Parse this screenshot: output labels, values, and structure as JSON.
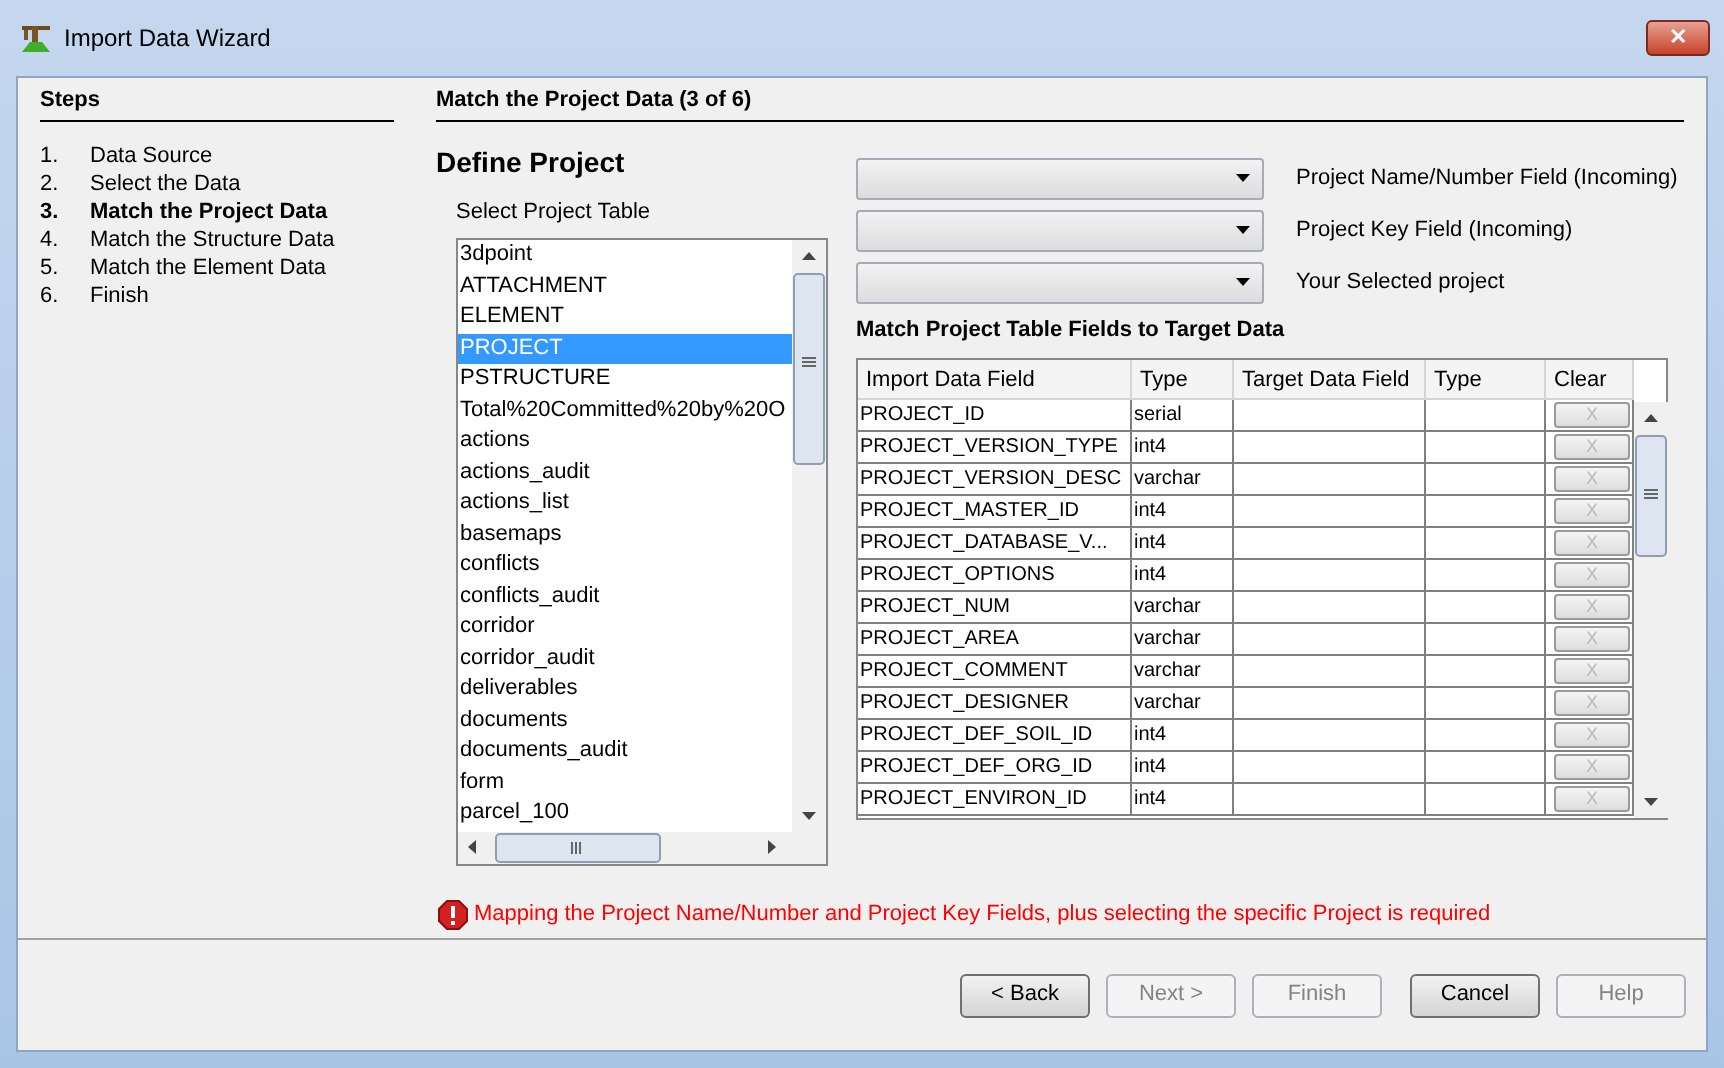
{
  "window": {
    "title": "Import Data Wizard",
    "close": "✕"
  },
  "steps": {
    "title": "Steps",
    "items": [
      {
        "number": "1.",
        "label": "Data Source",
        "selected": false
      },
      {
        "number": "2.",
        "label": "Select the Data",
        "selected": false
      },
      {
        "number": "3.",
        "label": "Match the Project Data",
        "selected": true
      },
      {
        "number": "4.",
        "label": "Match the Structure Data",
        "selected": false
      },
      {
        "number": "5.",
        "label": "Match the Element Data",
        "selected": false
      },
      {
        "number": "6.",
        "label": "Finish",
        "selected": false
      }
    ]
  },
  "page": {
    "title": "Match the Project Data (3 of 6)",
    "heading": "Define Project",
    "table_list": {
      "label": "Select Project Table",
      "items": [
        {
          "label": "3dpoint",
          "selected": false
        },
        {
          "label": "ATTACHMENT",
          "selected": false
        },
        {
          "label": "ELEMENT",
          "selected": false
        },
        {
          "label": "PROJECT",
          "selected": true
        },
        {
          "label": "PSTRUCTURE",
          "selected": false
        },
        {
          "label": "Total%20Committed%20by%20O",
          "selected": false
        },
        {
          "label": "actions",
          "selected": false
        },
        {
          "label": "actions_audit",
          "selected": false
        },
        {
          "label": "actions_list",
          "selected": false
        },
        {
          "label": "basemaps",
          "selected": false
        },
        {
          "label": "conflicts",
          "selected": false
        },
        {
          "label": "conflicts_audit",
          "selected": false
        },
        {
          "label": "corridor",
          "selected": false
        },
        {
          "label": "corridor_audit",
          "selected": false
        },
        {
          "label": "deliverables",
          "selected": false
        },
        {
          "label": "documents",
          "selected": false
        },
        {
          "label": "documents_audit",
          "selected": false
        },
        {
          "label": "form",
          "selected": false
        },
        {
          "label": "parcel_100",
          "selected": false
        }
      ]
    },
    "selectors": [
      {
        "label": "Project Name/Number Field (Incoming)"
      },
      {
        "label": "Project Key Field (Incoming)"
      },
      {
        "label": "Your Selected project"
      }
    ],
    "mapping": {
      "title": "Match Project Table Fields to Target Data",
      "columns": [
        "Import Data Field",
        "Type",
        "Target Data Field",
        "Type",
        "Clear"
      ],
      "rows": [
        {
          "field": "PROJECT_ID",
          "type": "serial",
          "clear": "X"
        },
        {
          "field": "PROJECT_VERSION_TYPE",
          "type": "int4",
          "clear": "X"
        },
        {
          "field": "PROJECT_VERSION_DESC",
          "type": "varchar",
          "clear": "X"
        },
        {
          "field": "PROJECT_MASTER_ID",
          "type": "int4",
          "clear": "X"
        },
        {
          "field": "PROJECT_DATABASE_V...",
          "type": "int4",
          "clear": "X"
        },
        {
          "field": "PROJECT_OPTIONS",
          "type": "int4",
          "clear": "X"
        },
        {
          "field": "PROJECT_NUM",
          "type": "varchar",
          "clear": "X"
        },
        {
          "field": "PROJECT_AREA",
          "type": "varchar",
          "clear": "X"
        },
        {
          "field": "PROJECT_COMMENT",
          "type": "varchar",
          "clear": "X"
        },
        {
          "field": "PROJECT_DESIGNER",
          "type": "varchar",
          "clear": "X"
        },
        {
          "field": "PROJECT_DEF_SOIL_ID",
          "type": "int4",
          "clear": "X"
        },
        {
          "field": "PROJECT_DEF_ORG_ID",
          "type": "int4",
          "clear": "X"
        },
        {
          "field": "PROJECT_ENVIRON_ID",
          "type": "int4",
          "clear": "X"
        }
      ]
    },
    "error": "Mapping the Project Name/Number and Project Key Fields, plus selecting the specific Project is required"
  },
  "buttons": [
    {
      "label": "< Back",
      "disabled": false
    },
    {
      "label": "Next >",
      "disabled": true
    },
    {
      "label": "Finish",
      "disabled": true
    },
    {
      "label": "Cancel",
      "disabled": false
    },
    {
      "label": "Help",
      "disabled": true
    }
  ]
}
